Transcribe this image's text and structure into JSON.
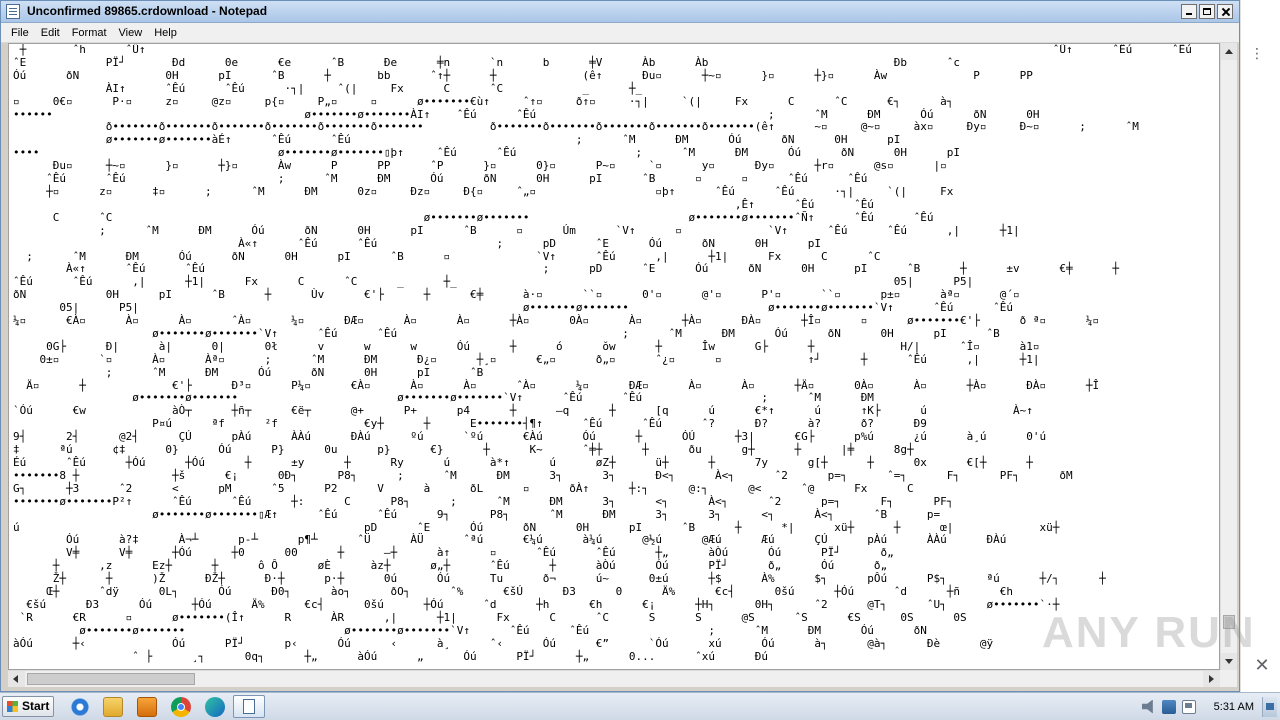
{
  "window": {
    "title": "Unconfirmed 89865.crdownload - Notepad"
  },
  "menu": [
    "File",
    "Edit",
    "Format",
    "View",
    "Help"
  ],
  "editor": {
    "lines": [
      " ┼       ˆh      ˆŰ↑                                                                                                                                         ˆŰ↑      ˆÊú      ˆÊú",
      "ˆE            PΪ┘       Ðd      0e      €e      ˆB      Ðe      ╪n      `n      b      ╪V      Àb      Àb                            Ðb      ˆc",
      "Óú      ðN             0H      pI      ˆB      ┼       bb      ˆ↑┼      ┼             (ê↑      Ðu▫      ┼~▫      }▫      ┼}▫      Àw             P      PP",
      "              ÀI↑      ˆÊú      ˆÊú      ·┐|     ˆ(|     Fx      C      ˆC            _      ┼_",
      "▫     0€▫      P·▫     z▫     @z▫     p{▫     P„▫     ▫      ø•••••••€ù↑     ˆ↑▫     ð↑▫     ·┐|     `(|     Fx      C      ˆC      €┐      à┐",
      "••••••                                      ø•••••••ø•••••••ÀI↑    ˆÊú      ˆÊú                                   ;      ˆM      ÐM      Óú      ðN      0H",
      "              ð•••••••ð•••••••ð•••••••ð•••••••ð•••••••ð•••••••          ð•••••••ð•••••••ð•••••••ð•••••••ð•••••••(ê↑      ~▫     @~▫     àx▫     Ðy▫     Ð~▫      ;      ˆM",
      "              ø•••••••ø•••••••àÉ↑      ˆÊú      ˆÊú                                  ;      ˆM      ÐM      Óú      ðN      0H      pI",
      "••••                                    ø•••••••ø•••••••▯þ↑     ˆÊú      ˆÊú                  ;      ˆM      ÐM      Óú      ðN      0H      pI",
      "      Ðu▫     ┼~▫      }▫      ┼}▫      Àw      P      PP      ˆP      }▫      0}▫      P~▫     `▫      y▫      Ðy▫      ┼r▫      @s▫      |▫",
      "     ˆÊú      ˆÊú                       ;      ˆM      ÐM      Óú      ðN      0H      pI      ˆB      ▫      ▫      ˆÊú      ˆÊú",
      "     ┼▫      z▫      ‡▫      ;      ˆM      ÐM      0z▫     Ðz▫     Ð{▫     ˆ„▫                  ▫þ↑      ˆÊú      ˆÊú      ·┐|     `(|     Fx",
      "                                                                                                             ‚Ê↑      ˆÊú      ˆÊú",
      "      C      ˆC                                               ø•••••••ø•••••••                        ø•••••••ø•••••••ˆÑ↑      ˆÊú      ˆÊú",
      "             ;      ˆM      ÐM      Óú      ðN      0H      pI      ˆB      ▫      Úm      `V↑      ▫             `V↑      ˆÊú      ˆÊú      ,|      ┼1|",
      "                                  À«↑      ˆÊú      ˆÊú                  ;      pD      ˆE      Óú      ðN      0H      pI",
      "  ;      ˆM      ÐM      Óú      ðN      0H      pI      ˆB      ▫             `V↑      ˆÊú      ,|      ┼1|      Fx      C      ˆC",
      "        À«↑      ˆÊú      ˆÊú                                                   ;      pD      ˆE      Óú      ðN      0H      pI      ˆB      ┼      ±v      €╪      ┼",
      "ˆÊú      ˆÊú      ,|      ┼1|      Fx      C      ˆC      _      ┼_                                                                  05|      P5|",
      "ðN            0H      pI      ˆB      ┼      Ùv      €'├      ┼      €╪      à·▫      ``▫      0'▫      @'▫      P'▫      ``▫      p±▫      àª▫      @´▫",
      "       05|      P5|                                                          ø•••••••ø•••••••                     ø•••••••ø•••••••`V↑      ˆÊú      ˆÊú",
      "¼▫      €À▫      À▫      À▫      ˆÀ▫      ¼▫      ÐÆ▫      À▫      À▫      ┼À▫      0À▫      À▫      ┼À▫      ÐÀ▫      ┼Î▫      ▫      ø•••••••€'├      ð ª▫      ¼▫",
      "                     ø•••••••ø•••••••`V↑      ˆÊú      ˆÊú                                  ;      ˆM      ÐM      Óú      ðN      0H      pI      ˆB",
      "     0G├      Ð|      à|      0|      0ł      v      w      w      Óú      ┼      ó      ŏw      ┼      Îw      G├      ┼             H/|      ˆÎ▫      à1▫",
      "    0±▫      `▫      À▫      Àª▫      ;      ˆM      ÐM      Ð¿▫      ┼¸▫      €„▫      ð„▫      ˆ¿▫      ▫             ↑┘      ┼      ˆÊú      ,|      ┼1|",
      "              ;      ˆM      ÐM      Óú      ðN      0H      pI      ˆB",
      "  Ä▫      ┼             €'├      Ð³▫      P¼▫      €À▫      À▫      À▫      ˆÀ▫      ¼▫      ÐÆ▫      À▫      À▫      ┼Ä▫      0À▫      À▫      ┼À▫      ÐÀ▫      ┼Î",
      "                  ø•••••••ø•••••••                        ø•••••••ø•••••••`V↑      ˆÊú      ˆÊú                  ;      ˆM      ÐM",
      "`Óú      €w             àÒ┬      ┼ñ┬      €ë┬      @+      P+      p4      ┼      —q      ┼      [q      ú      €*↑      ú      ↑K├      ú             À~↑",
      "                     P¤ú      ªf      ²f             €y┼      ┼      E•••••••┤¶↑      ˆÊú      ˆÊú      ˆ?      Ð?      à?      ð?      Ð9",
      "9┤      2┤      @2┤      ÇÚ      pÀú      ÀÀú      ÐÀú      ºú      `ºú      €Àú      Óú      ┼      ÓÚ      ┼3|      €G├      p%ú      ¿ú      à¸ú      0'ú",
      "‡      ªú      ¢‡      0}      Óú      P}      0u      p}      €}      ┼      K~      ˆ╪┼      ┼      ðu      g┼      ┼      |╪      8g┼",
      "Éú      ˆÊú      ┼Óú      ┼Óú      ┼      ±y      ┼      Ry      ú      à*↑      ú      øZ┼      ü┼      ┼      7y      g[┼      ┼      0x      €[┼      ┼",
      "•••••••8 ┼              ┼š      €¡      0Ð┐      P8┐      ;      ˆM      ÐM      3┐      3┐      Ð<┐      À<┐      ˆ2      p=┐      ˆ=┐      F┐      PF┐      ðM",
      "G┐      ┼3      ˆ2      <      pM      ˆ5      P2      V      à      ðL      ▫      ðÀ↑      ┼:┐      @:┐      @<      ˆ@      Fx      C",
      "•••••••ø•••••••P²↑      ˆÊú      ˆÊú      ┼:      C      P8┐      ;      ˆM      ÐM      3┐      <┐      À<┐      ˆ2      p=┐      F┐      PF┐",
      "                     ø•••••••ø•••••••▯Æ↑      ˆÊú      ˆÊú      9┐      P8┐      ˆM      ÐM      3┐      3┐      <┐      À<┐      ˆB      p=",
      "ú                                                    pD      ˆE      Óú      ðN      0H      pI      ˆB      ┼      *|      xü┼      ┼      œ|             xü┼",
      "        Óú      à?‡      À¬┴      p-┴      p¶┴      ˆÜ      ÀÜ      ˆªú      €¼ú      à¼ú      @½ú      @Æú      Æú      ÇÚ      pÀú      ÀÀú      ÐÀú",
      "        V╪      V╪      ┼Óú      ┼0      00      ┼      —┼      à↑      ▫      ˆÊú      ˆÊú      ┼„      àÒú      Óú      PΪ┘      ð„",
      "      ┼      ,z      Ez┼      ┼      ô Ô      øÈ      àz┼      ø„┼      ˆÊú      ┼      àÒú      Óú      PΪ┘      ð„      Óú      ð„",
      "      Ž┼      ┼      )Ž      ÐŽ┼      Ð·┼      p·┼      0ú      Óú      Tu      ð¬      ú~      0±ú      ┼$      À%      $┐      pÔú      P$┐      ªú      ┼/┐      ┼",
      "     Œ┼      ˆdÿ      0L┐      Óú      Ð0┐      ào┐      ðO┐      ˆ%      €šÚ      Ð3      0      Ä%      €c┤      0šú      ┼Óú      ˆd      ┼ñ      €h",
      "  €šú      Ð3      Óú      ┼Óú      Ä%      €c┤      0šú      ┼Óú      ˆd      ┼h      €h      €¡      ┼H┐      0H┐      ˆ2      @T┐      ˆU┐      ø•••••••`·┼",
      " `R      €R      ▫      ø•••••••(Î↑      R      ÀR      ,|      ┼1|      Fx      C      ˆC      S      S      @S      ˆS      €S      0S      0S",
      "          ø•••••••ø•••••••                        ø•••••••ø•••••••`V↑      ˆÊú      ˆÊú                  ;      ˆM      ÐM      Óú      ðN",
      "àÓú      ┼‹             Óú      PΪ┘      p‹      Óú      ‹      à¸      ˆ‹      Óú      €”      `Óú      xú      Óú      à┐      @à┐      Ðè      @ÿ",
      "                  ˆ ├      ¸┐      0q┐      ┼„      àÓú      „      Óú      PΪ┘      ┼„      0...      ˆxú      Ðú"
    ]
  },
  "scrollbars": {
    "vertical": {
      "up_icon": "scroll-up-arrow",
      "down_icon": "scroll-down-arrow",
      "position_fraction": 0.94
    },
    "horizontal": {
      "left_icon": "scroll-left-arrow",
      "right_icon": "scroll-right-arrow",
      "position_fraction": 0.0
    }
  },
  "watermark": {
    "text": "ANY RUN"
  },
  "taskbar": {
    "start_label": "Start",
    "pinned": [
      "internet-explorer-icon",
      "file-explorer-icon",
      "media-player-icon",
      "chrome-icon",
      "edge-icon",
      "notepad-icon"
    ],
    "clock": "5:31 AM"
  },
  "side_panel": {
    "menu_icon": "⋮",
    "close_icon": "✕"
  },
  "colors": {
    "titlebar_start": "#cfe0f4",
    "titlebar_end": "#aac6e8",
    "editor_bg": "#ffffff",
    "text": "#000000",
    "taskbar": "#dde5ef"
  }
}
